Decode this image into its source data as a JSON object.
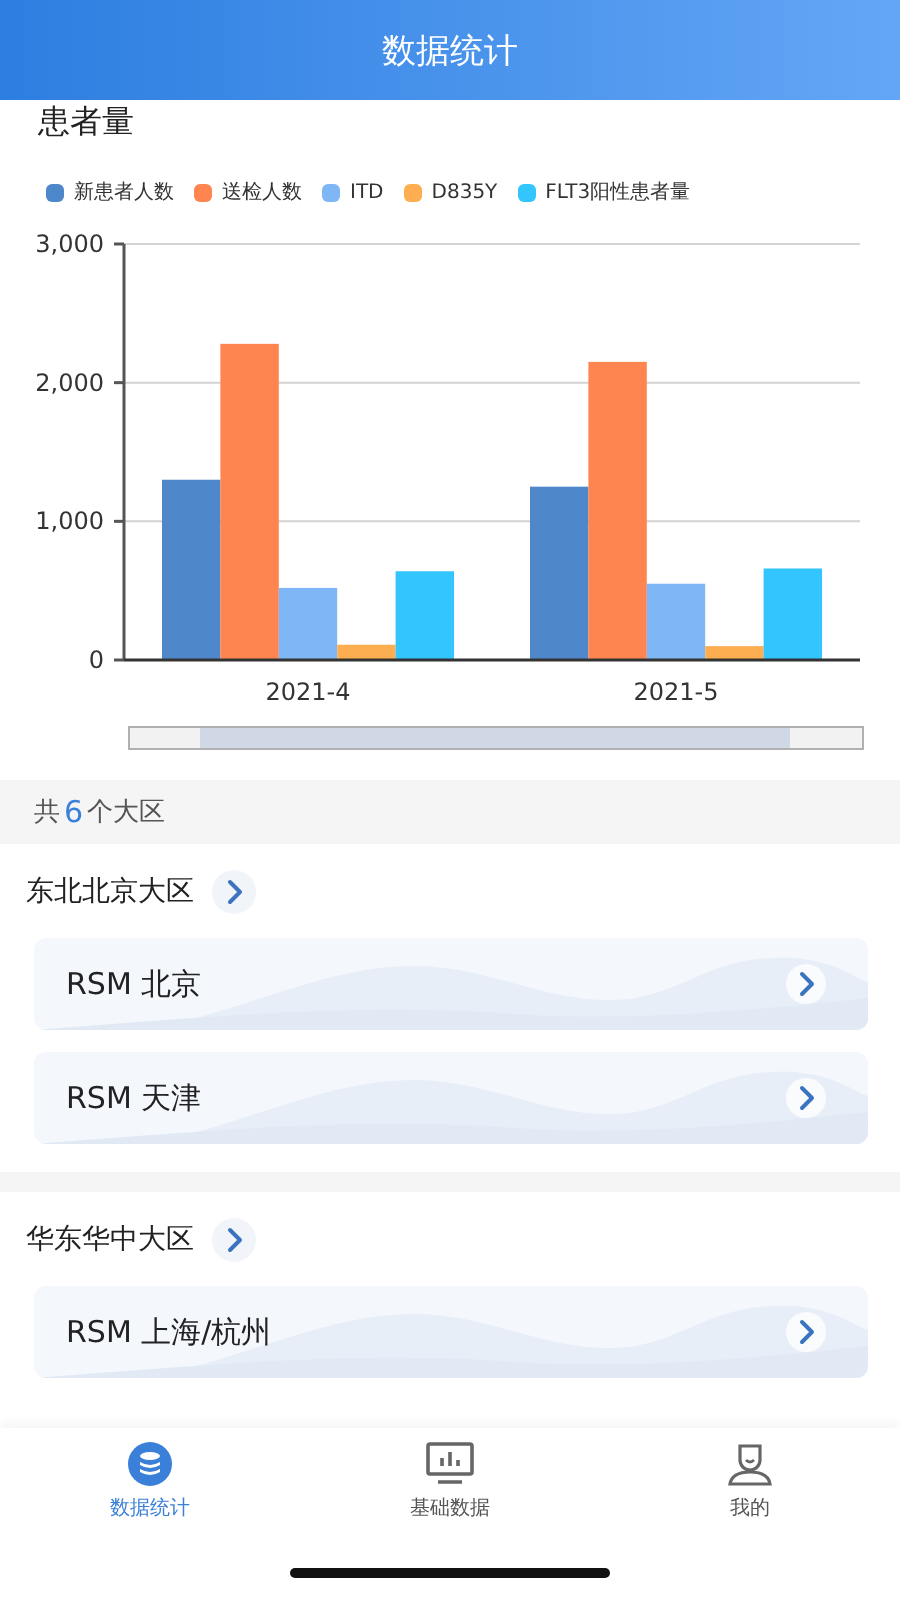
{
  "header": {
    "title": "数据统计"
  },
  "patient_section": {
    "title": "患者量",
    "chart_data": {
      "type": "bar",
      "categories": [
        "2021-4",
        "2021-5"
      ],
      "ylim": [
        0,
        3000
      ],
      "yticks": [
        {
          "value": 0,
          "label": "0"
        },
        {
          "value": 1000,
          "label": "1,000"
        },
        {
          "value": 2000,
          "label": "2,000"
        },
        {
          "value": 3000,
          "label": "3,000"
        }
      ],
      "series": [
        {
          "name": "新患者人数",
          "color": "#4f88ca",
          "values": [
            1300,
            1250
          ]
        },
        {
          "name": "送检人数",
          "color": "#fe8550",
          "values": [
            2280,
            2150
          ]
        },
        {
          "name": "ITD",
          "color": "#7fb6f6",
          "values": [
            520,
            550
          ]
        },
        {
          "name": "D835Y",
          "color": "#fcae50",
          "values": [
            110,
            100
          ]
        },
        {
          "name": "FLT3阳性患者量",
          "color": "#33c5fd",
          "values": [
            640,
            660
          ]
        }
      ]
    }
  },
  "region_summary": {
    "prefix": "共",
    "count": "6",
    "suffix": "个大区"
  },
  "regions": [
    {
      "name": "东北北京大区",
      "items": [
        "RSM 北京",
        "RSM 天津"
      ]
    },
    {
      "name": "华东华中大区",
      "items": [
        "RSM 上海/杭州"
      ]
    }
  ],
  "tab_bar": [
    {
      "label": "数据统计",
      "kind": "database",
      "selected": true
    },
    {
      "label": "基础数据",
      "kind": "monitor",
      "selected": false
    },
    {
      "label": "我的",
      "kind": "person",
      "selected": false
    }
  ]
}
